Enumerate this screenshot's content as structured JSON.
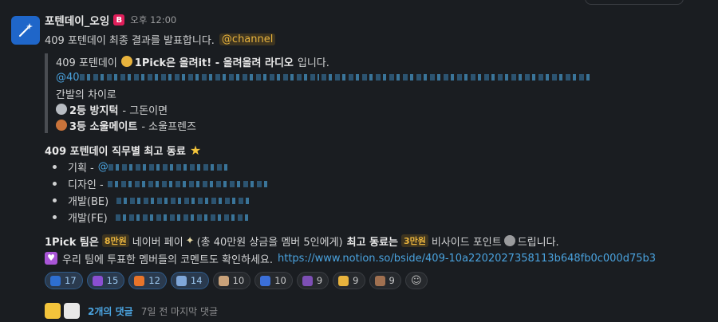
{
  "message": {
    "sender": "포텐데이_오잉",
    "app_badge": "B",
    "time": "오후 12:00",
    "announce": "409 포텐데이 최종 결과를 발표합니다.",
    "mention": "@channel"
  },
  "quote": {
    "line1_prefix": "409 포텐데이",
    "line1_bold": "1Pick은 올려it! - 올려올려 라디오",
    "line1_suffix": "입니다.",
    "mention_prefix": "@40",
    "line3": "간발의 차이로",
    "second_bold": "2등 방지턱",
    "second_rest": "- 그돈이면",
    "third_bold": "3등 소울메이트",
    "third_rest": "- 소울프렌즈"
  },
  "best": {
    "title": "409 포텐데이 직무별 최고 동료",
    "roles": [
      {
        "label": "기획 -",
        "mention_prefix": "@"
      },
      {
        "label": "디자인 -",
        "mention_prefix": ""
      },
      {
        "label": "개발(BE)",
        "mention_prefix": ""
      },
      {
        "label": "개발(FE)",
        "mention_prefix": ""
      }
    ]
  },
  "prize": {
    "p1": "1Pick 팀은",
    "tag1": "8만원",
    "p2": "네이버 페이",
    "p3": "(총 40만원 상금을 멤버 5인에게)",
    "p4": "최고 동료는",
    "tag2": "3만원",
    "p5": "비사이드 포인트",
    "p6": "드립니다."
  },
  "comment_line": {
    "text": "우리 팀에 투표한 멤버들의 코멘트도 확인하세요.",
    "url": "https://www.notion.so/bside/409-10a2202027358113b648fb0c000d75b3"
  },
  "reactions": [
    {
      "emoji": "sparkle-blue-icon",
      "count": "17",
      "color": "#2e6fd1",
      "highlight": true
    },
    {
      "emoji": "sparkle-purple-icon",
      "count": "15",
      "color": "#8a4fd1",
      "highlight": true
    },
    {
      "emoji": "fire-icon",
      "count": "12",
      "color": "#e8742a",
      "highlight": true
    },
    {
      "emoji": "party-icon",
      "count": "14",
      "color": "#7fa7d9",
      "highlight": true
    },
    {
      "emoji": "face-icon",
      "count": "10",
      "color": "#c9a27a",
      "highlight": false
    },
    {
      "emoji": "sparkles-icon",
      "count": "10",
      "color": "#3b6fd8",
      "highlight": false
    },
    {
      "emoji": "blob-icon",
      "count": "9",
      "color": "#7d4fb5",
      "highlight": false
    },
    {
      "emoji": "cat-icon",
      "count": "9",
      "color": "#e8b33d",
      "highlight": false
    },
    {
      "emoji": "hand-icon",
      "count": "9",
      "color": "#a07050",
      "highlight": false
    }
  ],
  "thread": {
    "replies": "2개의 댓글",
    "last": "7일 전 마지막 댓글"
  },
  "colors": {
    "background": "#1a1d21",
    "link": "#4aa3df",
    "mention": "#e8b33d"
  }
}
